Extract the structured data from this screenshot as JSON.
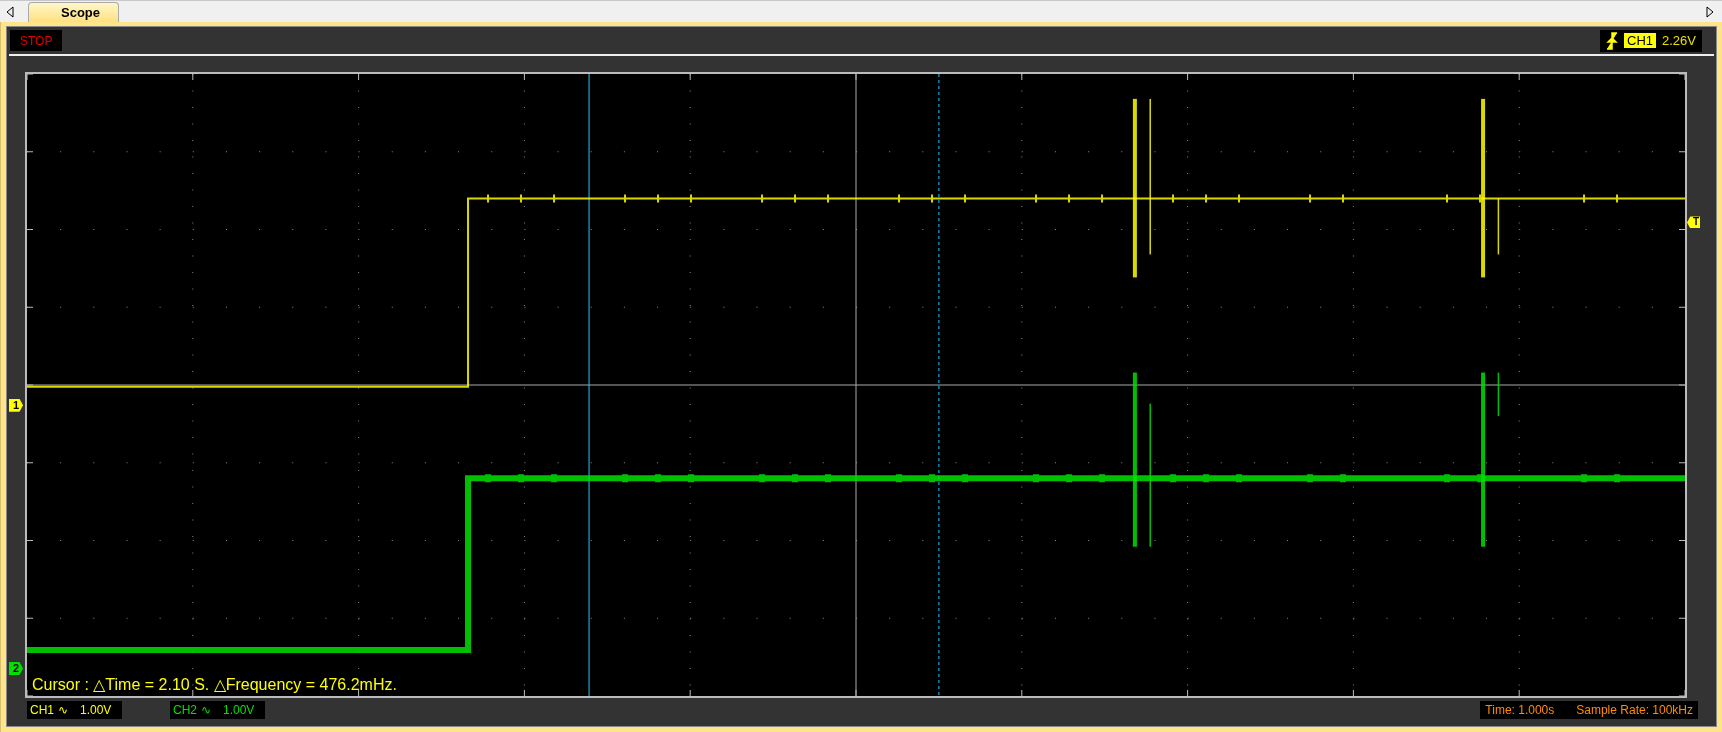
{
  "tab": {
    "label": "Scope",
    "selected": true
  },
  "run_state": "STOP",
  "trigger": {
    "channel": "CH1",
    "level": "2.26V",
    "marker": "T"
  },
  "channels": [
    {
      "label": "CH1",
      "coupling": "∿",
      "scale": "1.00V",
      "marker": "1",
      "color": "#ffff00"
    },
    {
      "label": "CH2",
      "coupling": "∿",
      "scale": "1.00V",
      "marker": "2",
      "color": "#00e000"
    }
  ],
  "cursor_readout": "Cursor : △Time = 2.10 S. △Frequency = 476.2mHz.",
  "timebase": "Time: 1.000s",
  "sample_rate": "Sample Rate: 100kHz"
}
